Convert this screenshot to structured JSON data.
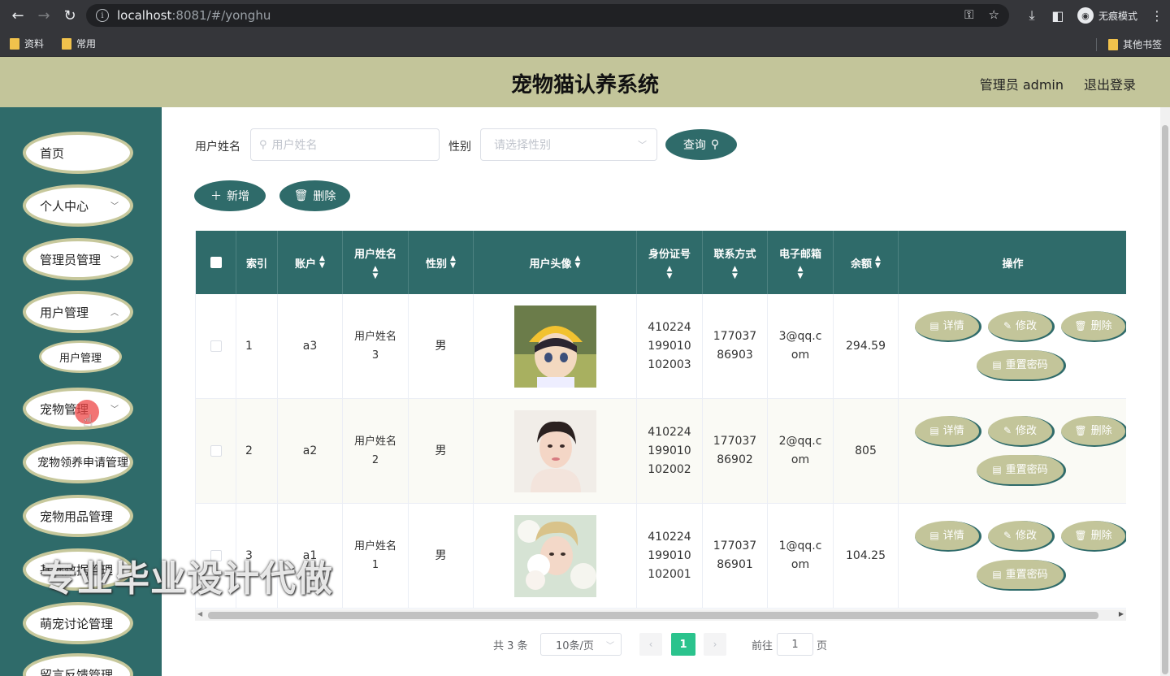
{
  "browser": {
    "url_host": "localhost",
    "url_rest": ":8081/#/yonghu",
    "incognito_label": "无痕模式",
    "bookmarks": [
      "资料",
      "常用"
    ],
    "other_bookmarks": "其他书签"
  },
  "header": {
    "title": "宠物猫认养系统",
    "admin_info": "管理员 admin",
    "logout": "退出登录"
  },
  "sidebar": {
    "items": [
      {
        "label": "首页",
        "has_chevron": false
      },
      {
        "label": "个人中心",
        "has_chevron": true
      },
      {
        "label": "管理员管理",
        "has_chevron": true
      },
      {
        "label": "用户管理",
        "has_chevron": true
      },
      {
        "label": "宠物管理",
        "has_chevron": true
      },
      {
        "label": "宠物领养申请管理",
        "has_chevron": false
      },
      {
        "label": "宠物用品管理",
        "has_chevron": false
      },
      {
        "label": "基础数据管理",
        "has_chevron": false
      },
      {
        "label": "萌宠讨论管理",
        "has_chevron": false
      },
      {
        "label": "留言反馈管理",
        "has_chevron": false
      }
    ],
    "sub_item": "用户管理"
  },
  "filters": {
    "name_label": "用户姓名",
    "name_placeholder": "用户姓名",
    "gender_label": "性别",
    "gender_placeholder": "请选择性别",
    "query_button": "查询"
  },
  "actions": {
    "add_button": "新增",
    "delete_button": "删除"
  },
  "table": {
    "columns": [
      "索引",
      "账户",
      "用户姓名",
      "性别",
      "用户头像",
      "身份证号",
      "联系方式",
      "电子邮箱",
      "余额",
      "操作"
    ],
    "rows": [
      {
        "index": "1",
        "account": "a3",
        "name": "用户姓名3",
        "gender": "男",
        "id_card": "410224199010102003",
        "phone": "17703786903",
        "email": "3@qq.com",
        "balance": "294.59"
      },
      {
        "index": "2",
        "account": "a2",
        "name": "用户姓名2",
        "gender": "男",
        "id_card": "410224199010102002",
        "phone": "17703786902",
        "email": "2@qq.com",
        "balance": "805"
      },
      {
        "index": "3",
        "account": "a1",
        "name": "用户姓名1",
        "gender": "男",
        "id_card": "410224199010102001",
        "phone": "17703786901",
        "email": "1@qq.com",
        "balance": "104.25"
      }
    ],
    "op_detail": "详情",
    "op_edit": "修改",
    "op_delete": "删除",
    "op_reset": "重置密码"
  },
  "pagination": {
    "total": "共 3 条",
    "page_size": "10条/页",
    "current_page": "1",
    "goto_label": "前往",
    "goto_value": "1",
    "page_unit": "页"
  },
  "watermark": "专业毕业设计代做",
  "colors": {
    "primary": "#2f6b6a",
    "accent": "#c3c59a",
    "pager_active": "#2bc38d"
  }
}
